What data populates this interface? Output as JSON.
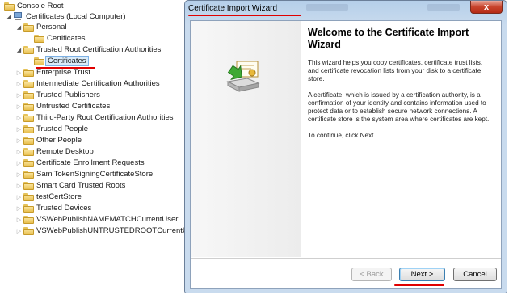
{
  "tree": {
    "root": "Console Root",
    "computer": "Certificates (Local Computer)",
    "personal": "Personal",
    "personal_child": "Certificates",
    "trusted_root": "Trusted Root Certification Authorities",
    "trusted_root_child": "Certificates",
    "items": [
      "Enterprise Trust",
      "Intermediate Certification Authorities",
      "Trusted Publishers",
      "Untrusted Certificates",
      "Third-Party Root Certification Authorities",
      "Trusted People",
      "Other People",
      "Remote Desktop",
      "Certificate Enrollment Requests",
      "SamlTokenSigningCertificateStore",
      "Smart Card Trusted Roots",
      "testCertStore",
      "Trusted Devices",
      "VSWebPublishNAMEMATCHCurrentUser",
      "VSWebPublishUNTRUSTEDROOTCurrentUs"
    ]
  },
  "window": {
    "title": "Certificate Import Wizard",
    "close_glyph": "x",
    "heading": "Welcome to the Certificate Import Wizard",
    "para1": "This wizard helps you copy certificates, certificate trust lists, and certificate revocation lists from your disk to a certificate store.",
    "para2": "A certificate, which is issued by a certification authority, is a confirmation of your identity and contains information used to protect data or to establish secure network connections. A certificate store is the system area where certificates are kept.",
    "para3": "To continue, click Next.",
    "back_label": "< Back",
    "next_label": "Next >",
    "cancel_label": "Cancel"
  },
  "colors": {
    "annotation_red": "#e00000",
    "selection": "#d9ebf9",
    "folder": "#e8bf4e"
  }
}
